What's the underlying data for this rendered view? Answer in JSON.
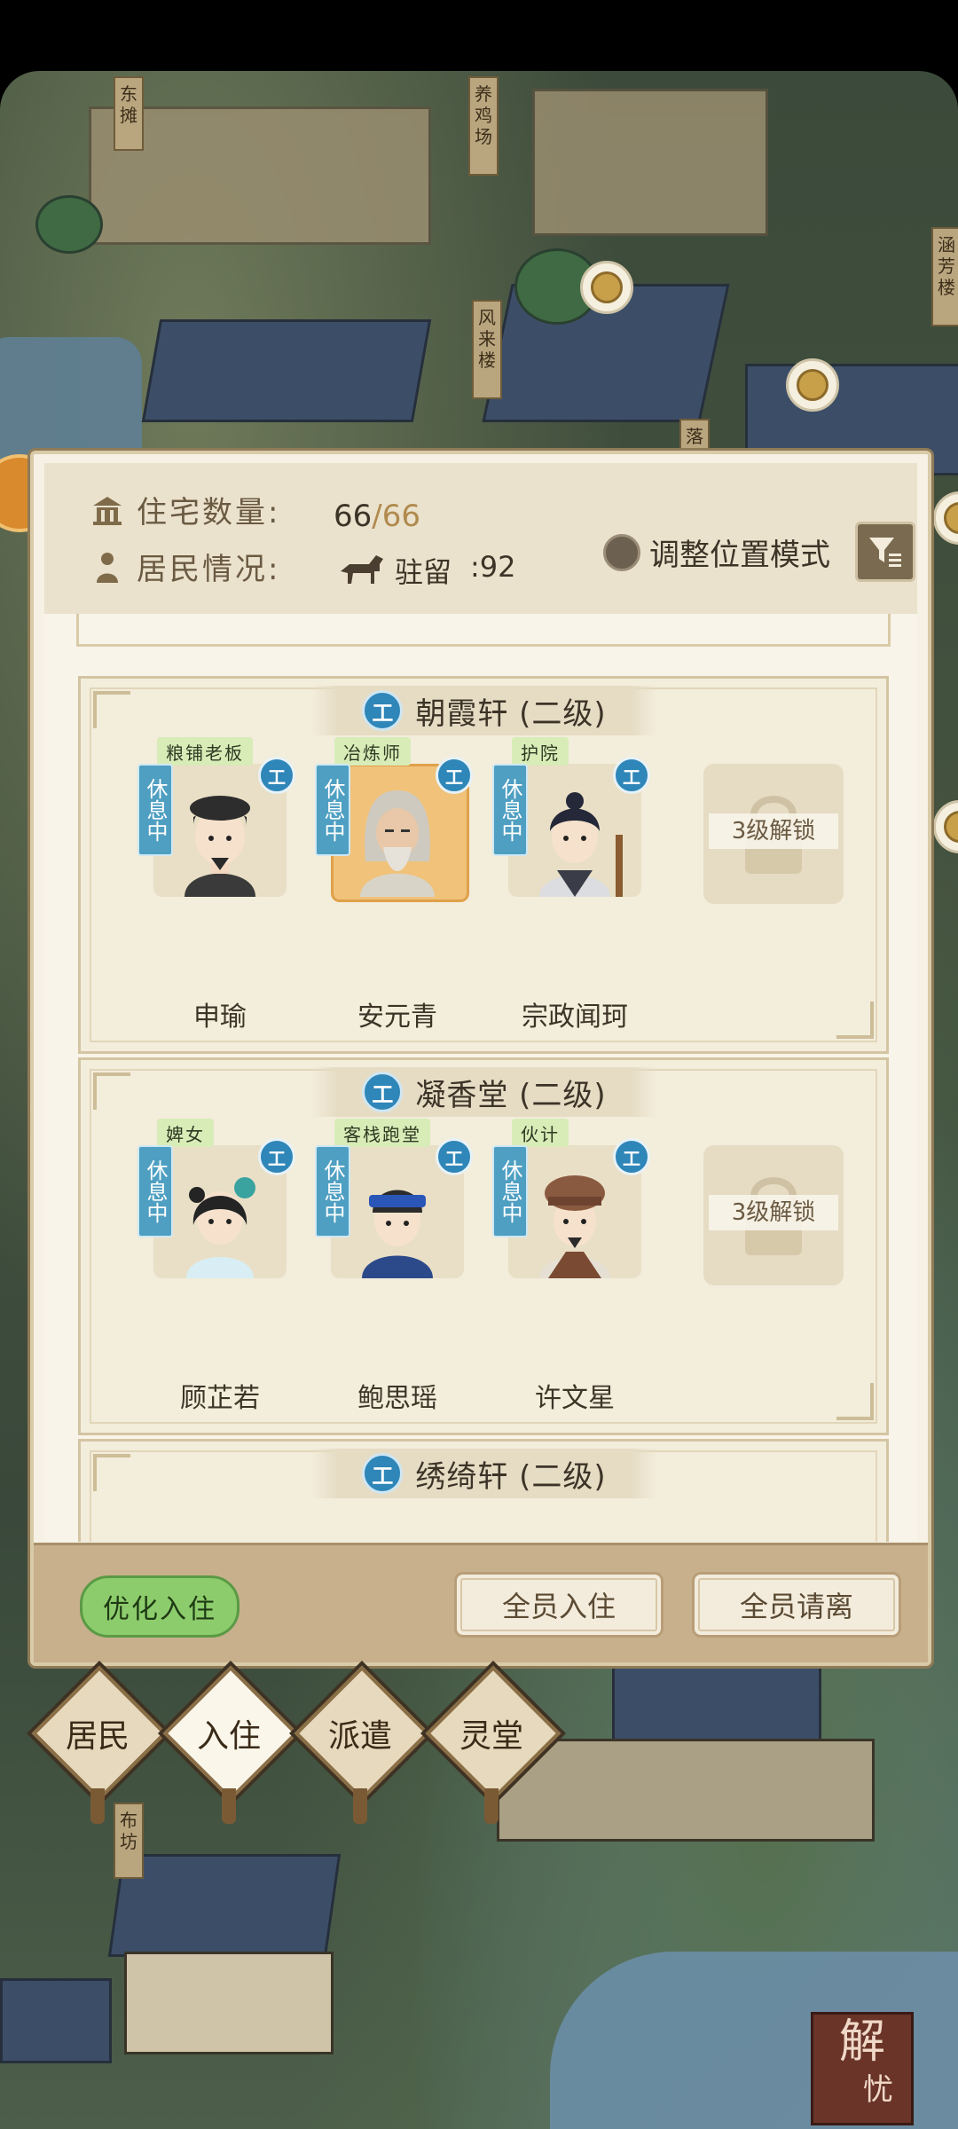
{
  "map": {
    "signs": [
      "东摊",
      "养鸡场",
      "风来楼",
      "涵芳楼",
      "落",
      "布坊"
    ]
  },
  "header": {
    "housing_label": "住宅数量:",
    "housing_current": "66",
    "housing_max": "/66",
    "residents_label": "居民情况:",
    "stay_label": "驻留",
    "stay_value": ":92",
    "mode_label": "调整位置模式"
  },
  "houses": [
    {
      "badge": "工",
      "title": "朝霞轩 (二级)",
      "residents": [
        {
          "job": "粮铺老板",
          "status": "休息中",
          "badge": "工",
          "name": "申瑜"
        },
        {
          "job": "冶炼师",
          "status": "休息中",
          "badge": "工",
          "name": "安元青"
        },
        {
          "job": "护院",
          "status": "休息中",
          "badge": "工",
          "name": "宗政闻珂"
        }
      ],
      "locked_label": "3级解锁"
    },
    {
      "badge": "工",
      "title": "凝香堂 (二级)",
      "residents": [
        {
          "job": "婢女",
          "status": "休息中",
          "badge": "工",
          "name": "顾芷若"
        },
        {
          "job": "客栈跑堂",
          "status": "休息中",
          "badge": "工",
          "name": "鲍思瑶"
        },
        {
          "job": "伙计",
          "status": "休息中",
          "badge": "工",
          "name": "许文星"
        }
      ],
      "locked_label": "3级解锁"
    },
    {
      "badge": "工",
      "title": "绣绮轩 (二级)"
    }
  ],
  "footer": {
    "optimize": "优化入住",
    "all_in": "全员入住",
    "all_out": "全员请离"
  },
  "nav": [
    "居民",
    "入住",
    "派遣",
    "灵堂"
  ],
  "seal": {
    "top": "解",
    "bottom": "忧"
  }
}
